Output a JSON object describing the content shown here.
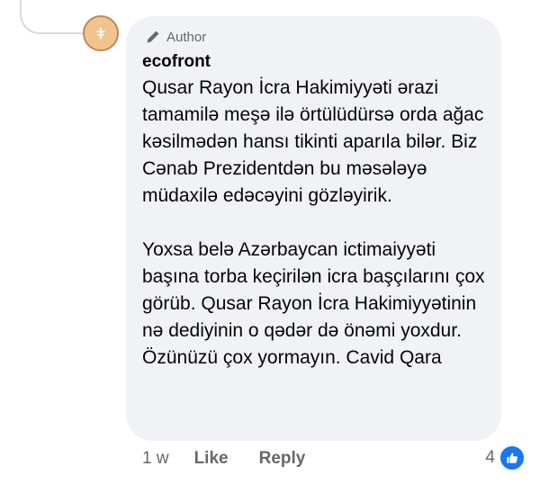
{
  "comment": {
    "badge_label": "Author",
    "commenter_name": "ecofront",
    "paragraphs": [
      "Qusar Rayon İcra Hakimiyyəti ərazi tamamilə meşə ilə örtülüdürsə orda ağac kəsilmədən hansı tikinti aparıla bilər. Biz Cənab Prezidentdən bu məsələyə müdaxilə edəcəyini gözləyirik.",
      "Yoxsa belə Azərbaycan ictimaiyyəti başına torba keçirilən icra başçılarını çox görüb. Qusar Rayon İcra Hakimiyyətinin nə dediyinin o qədər də önəmi yoxdur. Özünüzü çox yormayın. Cavid Qara"
    ]
  },
  "actions": {
    "timestamp": "1 w",
    "like_label": "Like",
    "reply_label": "Reply",
    "reaction_count": "4"
  },
  "icons": {
    "author_badge": "pen-icon",
    "avatar": "avatar-icon",
    "reaction": "thumbs-up-icon"
  },
  "colors": {
    "bubble_background": "#f0f2f5",
    "secondary_text": "#65676b",
    "like_blue": "#1877f2",
    "avatar_fill": "#f2c48d"
  }
}
